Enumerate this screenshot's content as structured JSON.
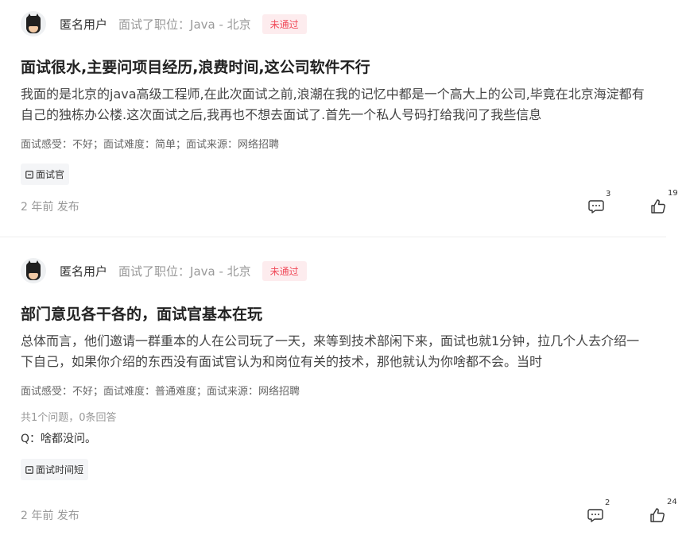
{
  "reviews": [
    {
      "user": "匿名用户",
      "position": "面试了职位：Java - 北京",
      "status": "未通过",
      "title": "面试很水,主要问项目经历,浪费时间,这公司软件不行",
      "body": "我面的是北京的java高级工程师,在此次面试之前,浪潮在我的记忆中都是一个高大上的公司,毕竟在北京海淀都有自己的独栋办公楼.这次面试之后,我再也不想去面试了.首先一个私人号码打给我问了我些信息",
      "meta": "面试感受：不好；面试难度：简单；面试来源：网络招聘",
      "tag": "面试官",
      "time": "2 年前 发布",
      "comments": "3",
      "likes": "19"
    },
    {
      "user": "匿名用户",
      "position": "面试了职位：Java - 北京",
      "status": "未通过",
      "title": "部门意见各干各的，面试官基本在玩",
      "body": "总体而言，他们邀请一群重本的人在公司玩了一天，来等到技术部闲下来，面试也就1分钟，拉几个人去介绍一下自己，如果你介绍的东西没有面试官认为和岗位有关的技术，那他就认为你啥都不会。当时",
      "meta": "面试感受：不好；面试难度：普通难度；面试来源：网络招聘",
      "qa_count": "共1个问题，0条回答",
      "qa_question": "Q：啥都没问。",
      "tag": "面试时间短",
      "time": "2 年前 发布",
      "comments": "2",
      "likes": "24"
    }
  ]
}
